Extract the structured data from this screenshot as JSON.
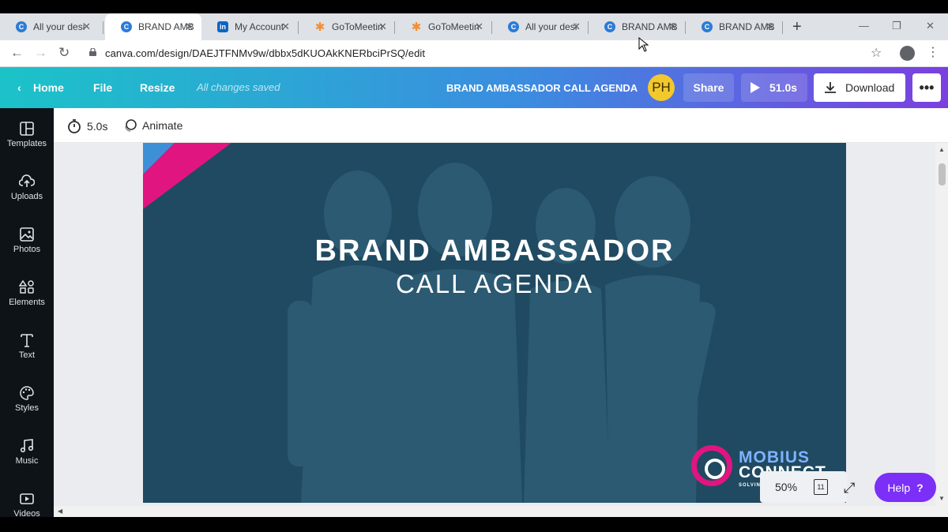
{
  "browser": {
    "tabs": [
      {
        "title": "All your desi",
        "favicon": "canva-icon",
        "active": false
      },
      {
        "title": "BRAND AMB",
        "favicon": "canva-icon",
        "active": true
      },
      {
        "title": "My Account",
        "favicon": "linkedin-icon",
        "active": false
      },
      {
        "title": "GoToMeetin",
        "favicon": "gotomeeting-icon",
        "active": false
      },
      {
        "title": "GoToMeetin",
        "favicon": "gotomeeting-icon",
        "active": false
      },
      {
        "title": "All your desi",
        "favicon": "canva-icon",
        "active": false
      },
      {
        "title": "BRAND AMB",
        "favicon": "canva-icon",
        "active": false
      },
      {
        "title": "BRAND AMB",
        "favicon": "canva-icon",
        "active": false
      }
    ],
    "url": "canva.com/design/DAEJTFNMv9w/dbbx5dKUOAkKNERbciPrSQ/edit"
  },
  "header": {
    "home_label": "Home",
    "file_label": "File",
    "resize_label": "Resize",
    "saved_status": "All changes saved",
    "doc_title": "BRAND AMBASSADOR CALL AGENDA",
    "avatar_initials": "PH",
    "share_label": "Share",
    "play_label": "51.0s",
    "download_label": "Download",
    "more_label": "•••",
    "accent_start": "#1bc3c8",
    "accent_end": "#7b3fe0"
  },
  "sidepanel": {
    "items": [
      {
        "label": "Templates",
        "icon": "templates-icon"
      },
      {
        "label": "Uploads",
        "icon": "upload-cloud-icon"
      },
      {
        "label": "Photos",
        "icon": "photo-icon"
      },
      {
        "label": "Elements",
        "icon": "shapes-icon"
      },
      {
        "label": "Text",
        "icon": "text-icon"
      },
      {
        "label": "Styles",
        "icon": "palette-icon"
      },
      {
        "label": "Music",
        "icon": "music-icon"
      },
      {
        "label": "Videos",
        "icon": "video-icon"
      }
    ]
  },
  "toolbar": {
    "duration_label": "5.0s",
    "animate_label": "Animate"
  },
  "slide": {
    "title_line1": "BRAND AMBASSADOR",
    "title_line2": "CALL AGENDA",
    "logo_line1": "MOBIUS",
    "logo_line2": "CONNECT",
    "logo_tagline": "SOLVING",
    "bg_color": "#1f4a61",
    "accent_pink": "#e0157f",
    "accent_blue": "#3d8fd6"
  },
  "footer": {
    "zoom": "50%",
    "page_count": "11",
    "help_label": "Help",
    "help_icon_glyph": "?"
  }
}
